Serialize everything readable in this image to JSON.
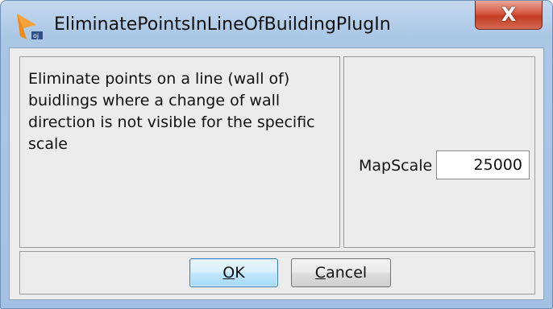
{
  "window": {
    "title": "EliminatePointsInLineOfBuildingPlugIn",
    "close_label": "X",
    "icon": "plugin-app-icon"
  },
  "description": "Eliminate points on a line (wall of) buidlings where a change of wall direction is not visible for the specific scale",
  "map_scale": {
    "label": "MapScale",
    "value": "25000"
  },
  "buttons": {
    "ok": {
      "mnemonic": "O",
      "rest": "K"
    },
    "cancel": {
      "mnemonic": "C",
      "rest": "ancel"
    }
  },
  "colors": {
    "accent_icon": "#f08a1c",
    "close_button": "#c8432b",
    "default_button_border": "#3c7fb1"
  }
}
